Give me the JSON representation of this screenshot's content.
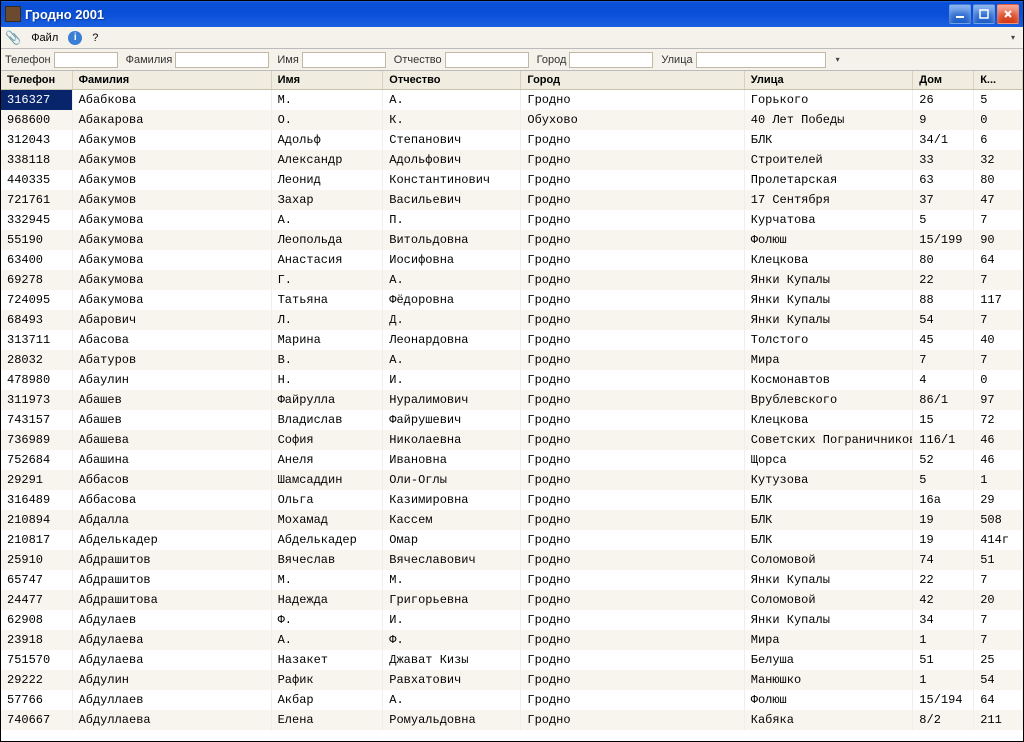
{
  "window": {
    "title": "Гродно 2001"
  },
  "menubar": {
    "file": "Файл",
    "help": "?"
  },
  "filters": {
    "phone": "Телефон",
    "lastname": "Фамилия",
    "firstname": "Имя",
    "patronymic": "Отчество",
    "city": "Город",
    "street": "Улица"
  },
  "headers": {
    "phone": "Телефон",
    "lastname": "Фамилия",
    "firstname": "Имя",
    "patronymic": "Отчество",
    "city": "Город",
    "street": "Улица",
    "house": "Дом",
    "apt": "К..."
  },
  "rows": [
    {
      "phone": "316327",
      "lastname": "Абабкова",
      "firstname": "М.",
      "patronymic": "А.",
      "city": "Гродно",
      "street": "Горького",
      "house": "26",
      "apt": "5"
    },
    {
      "phone": "968600",
      "lastname": "Абакарова",
      "firstname": "О.",
      "patronymic": "К.",
      "city": "Обухово",
      "street": "40 Лет Победы",
      "house": "9",
      "apt": "0"
    },
    {
      "phone": "312043",
      "lastname": "Абакумов",
      "firstname": "Адольф",
      "patronymic": "Степанович",
      "city": "Гродно",
      "street": "БЛК",
      "house": "34/1",
      "apt": "6"
    },
    {
      "phone": "338118",
      "lastname": "Абакумов",
      "firstname": "Александр",
      "patronymic": "Адольфович",
      "city": "Гродно",
      "street": "Строителей",
      "house": "33",
      "apt": "32"
    },
    {
      "phone": "440335",
      "lastname": "Абакумов",
      "firstname": "Леонид",
      "patronymic": "Константинович",
      "city": "Гродно",
      "street": "Пролетарская",
      "house": "63",
      "apt": "80"
    },
    {
      "phone": "721761",
      "lastname": "Абакумов",
      "firstname": "Захар",
      "patronymic": "Васильевич",
      "city": "Гродно",
      "street": "17 Сентября",
      "house": "37",
      "apt": "47"
    },
    {
      "phone": "332945",
      "lastname": "Абакумова",
      "firstname": "А.",
      "patronymic": "П.",
      "city": "Гродно",
      "street": "Курчатова",
      "house": "5",
      "apt": "7"
    },
    {
      "phone": "55190",
      "lastname": "Абакумова",
      "firstname": "Леопольда",
      "patronymic": "Витольдовна",
      "city": "Гродно",
      "street": "Фолюш",
      "house": "15/199",
      "apt": "90"
    },
    {
      "phone": "63400",
      "lastname": "Абакумова",
      "firstname": "Анастасия",
      "patronymic": "Иосифовна",
      "city": "Гродно",
      "street": "Клецкова",
      "house": "80",
      "apt": "64"
    },
    {
      "phone": "69278",
      "lastname": "Абакумова",
      "firstname": "Г.",
      "patronymic": "А.",
      "city": "Гродно",
      "street": "Янки Купалы",
      "house": "22",
      "apt": "7"
    },
    {
      "phone": "724095",
      "lastname": "Абакумова",
      "firstname": "Татьяна",
      "patronymic": "Фёдоровна",
      "city": "Гродно",
      "street": "Янки Купалы",
      "house": "88",
      "apt": "117"
    },
    {
      "phone": "68493",
      "lastname": "Абарович",
      "firstname": "Л.",
      "patronymic": "Д.",
      "city": "Гродно",
      "street": "Янки Купалы",
      "house": "54",
      "apt": "7"
    },
    {
      "phone": "313711",
      "lastname": "Абасова",
      "firstname": "Марина",
      "patronymic": "Леонардовна",
      "city": "Гродно",
      "street": "Толстого",
      "house": "45",
      "apt": "40"
    },
    {
      "phone": "28032",
      "lastname": "Абатуров",
      "firstname": "В.",
      "patronymic": "А.",
      "city": "Гродно",
      "street": "Мира",
      "house": "7",
      "apt": "7"
    },
    {
      "phone": "478980",
      "lastname": "Абаулин",
      "firstname": "Н.",
      "patronymic": "И.",
      "city": "Гродно",
      "street": "Космонавтов",
      "house": "4",
      "apt": "0"
    },
    {
      "phone": "311973",
      "lastname": "Абашев",
      "firstname": "Файрулла",
      "patronymic": "Нуралимович",
      "city": "Гродно",
      "street": "Врублевского",
      "house": "86/1",
      "apt": "97"
    },
    {
      "phone": "743157",
      "lastname": "Абашев",
      "firstname": "Владислав",
      "patronymic": "Файрушевич",
      "city": "Гродно",
      "street": "Клецкова",
      "house": "15",
      "apt": "72"
    },
    {
      "phone": "736989",
      "lastname": "Абашева",
      "firstname": "София",
      "patronymic": "Николаевна",
      "city": "Гродно",
      "street": "Советских Пограничников",
      "house": "116/1",
      "apt": "46"
    },
    {
      "phone": "752684",
      "lastname": "Абашина",
      "firstname": "Анеля",
      "patronymic": "Ивановна",
      "city": "Гродно",
      "street": "Щорса",
      "house": "52",
      "apt": "46"
    },
    {
      "phone": "29291",
      "lastname": "Аббасов",
      "firstname": "Шамсаддин",
      "patronymic": "Оли-Оглы",
      "city": "Гродно",
      "street": "Кутузова",
      "house": "5",
      "apt": "1"
    },
    {
      "phone": "316489",
      "lastname": "Аббасова",
      "firstname": "Ольга",
      "patronymic": "Казимировна",
      "city": "Гродно",
      "street": "БЛК",
      "house": "16а",
      "apt": "29"
    },
    {
      "phone": "210894",
      "lastname": "Абдалла",
      "firstname": "Мохамад",
      "patronymic": "Кассем",
      "city": "Гродно",
      "street": "БЛК",
      "house": "19",
      "apt": "508"
    },
    {
      "phone": "210817",
      "lastname": "Абделькадер",
      "firstname": "Абделькадер",
      "patronymic": "Омар",
      "city": "Гродно",
      "street": "БЛК",
      "house": "19",
      "apt": "414г"
    },
    {
      "phone": "25910",
      "lastname": "Абдрашитов",
      "firstname": "Вячеслав",
      "patronymic": "Вячеславович",
      "city": "Гродно",
      "street": "Соломовой",
      "house": "74",
      "apt": "51"
    },
    {
      "phone": "65747",
      "lastname": "Абдрашитов",
      "firstname": "М.",
      "patronymic": "М.",
      "city": "Гродно",
      "street": "Янки Купалы",
      "house": "22",
      "apt": "7"
    },
    {
      "phone": "24477",
      "lastname": "Абдрашитова",
      "firstname": "Надежда",
      "patronymic": "Григорьевна",
      "city": "Гродно",
      "street": "Соломовой",
      "house": "42",
      "apt": "20"
    },
    {
      "phone": "62908",
      "lastname": "Абдулаев",
      "firstname": "Ф.",
      "patronymic": "И.",
      "city": "Гродно",
      "street": "Янки Купалы",
      "house": "34",
      "apt": "7"
    },
    {
      "phone": "23918",
      "lastname": "Абдулаева",
      "firstname": "А.",
      "patronymic": "Ф.",
      "city": "Гродно",
      "street": "Мира",
      "house": "1",
      "apt": "7"
    },
    {
      "phone": "751570",
      "lastname": "Абдулаева",
      "firstname": "Назакет",
      "patronymic": "Джават Кизы",
      "city": "Гродно",
      "street": "Белуша",
      "house": "51",
      "apt": "25"
    },
    {
      "phone": "29222",
      "lastname": "Абдулин",
      "firstname": "Рафик",
      "patronymic": "Равхатович",
      "city": "Гродно",
      "street": "Манюшко",
      "house": "1",
      "apt": "54"
    },
    {
      "phone": "57766",
      "lastname": "Абдуллаев",
      "firstname": "Акбар",
      "patronymic": "А.",
      "city": "Гродно",
      "street": "Фолюш",
      "house": "15/194",
      "apt": "64"
    },
    {
      "phone": "740667",
      "lastname": "Абдуллаева",
      "firstname": "Елена",
      "patronymic": "Ромуальдовна",
      "city": "Гродно",
      "street": "Кабяка",
      "house": "8/2",
      "apt": "211"
    }
  ]
}
